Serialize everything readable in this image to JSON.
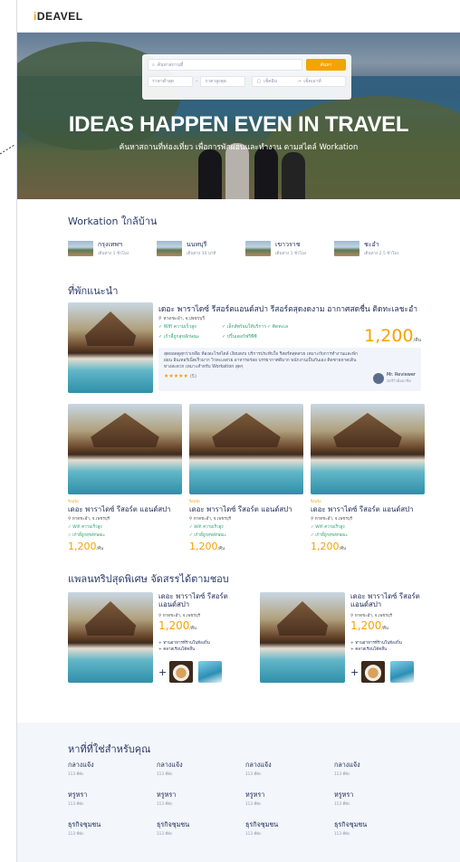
{
  "brand": {
    "logo_i": "i",
    "logo_rest": "DEAVEL"
  },
  "hero": {
    "title": "IDEAS HAPPEN EVEN IN TRAVEL",
    "subtitle": "ค้นหาสถานที่ท่องเที่ยว เพื่อการพักผ่อนและทำงาน ตามสไตล์ Workation",
    "search_placeholder": "ค้นหาสถานที่",
    "search_button": "ค้นหา",
    "price_min": "ราคาต่ำสุด",
    "price_sep": "–",
    "price_max": "ราคาสูงสุด",
    "date_start": "เช็คอิน",
    "date_arrow": "→",
    "date_end": "เช็คเอาท์"
  },
  "nearby": {
    "title": "Workation ใกล้บ้าน",
    "items": [
      {
        "name": "กรุงเทพฯ",
        "sub": "เดินทาง 1 ชั่วโมง"
      },
      {
        "name": "นนทบุรี",
        "sub": "เดินทาง 30 นาที"
      },
      {
        "name": "เขาวราช",
        "sub": "เดินทาง 1 ชั่วโมง"
      },
      {
        "name": "ชะอำ",
        "sub": "เดินทาง 2.5 ชั่วโมง"
      }
    ]
  },
  "recommended": {
    "title": "ที่พักแนะนำ",
    "featured": {
      "title": "เดอะ พาราไดซ์ รีสอร์ตแอนด์สปา รีสอร์ตสุดงดงาม อากาศสดชื่น ติดทะเลชะอำ",
      "location": "หาดชะอำ, จ.เพชรบุรี",
      "tags": [
        "Wifi ความเร็วสูง",
        "เล็กส์พร้อมให้บริการ",
        "ติดทะเล",
        "เก้าอี้ถูกสุขลักษณะ",
        "ปริ้นเตอร์ฟรีพีซี"
      ],
      "price": "1,200",
      "unit": "/คืน",
      "review": "สุดยอดดูสุกว่าเหลือ ห้องอะไรสไตล์ เงียบสงบ บริการประทับใจ รีสอร์ตสุดสวย เหมาะกับการทำงานและพักผ่อน อินเทอร์เน็ตเร็วมาก วิวทะเลสวย อาหารอร่อย บรรยากาศดีมาก พนักงานเป็นกันเอง ติดชายหาดเดินทางสะดวก เหมาะสำหรับ Workation สุดๆ",
      "stars": "★★★★★",
      "review_count": "(5)",
      "reviewer": "Mr. Reviewer",
      "reviewer_role": "นักรีวิวมืออาชีพ"
    },
    "cards": [
      {
        "category": "รีสอร์ต",
        "title": "เดอะ พาราไดซ์ รีสอร์ต แอนด์สปา",
        "location": "หาดชะอำ, จ.เพชรบุรี",
        "tag1": "Wifi ความเร็วสูง",
        "tag2": "เก้าอี้ถูกสุขลักษณะ",
        "price": "1,200",
        "unit": "/คืน"
      },
      {
        "category": "รีสอร์ต",
        "title": "เดอะ พาราไดซ์ รีสอร์ต แอนด์สปา",
        "location": "หาดชะอำ, จ.เพชรบุรี",
        "tag1": "Wifi ความเร็วสูง",
        "tag2": "เก้าอี้ถูกสุขลักษณะ",
        "price": "1,200",
        "unit": "/คืน"
      },
      {
        "category": "รีสอร์ต",
        "title": "เดอะ พาราไดซ์ รีสอร์ต แอนด์สปา",
        "location": "หาดชะอำ, จ.เพชรบุรี",
        "tag1": "Wifi ความเร็วสูง",
        "tag2": "เก้าอี้ถูกสุขลักษณะ",
        "price": "1,200",
        "unit": "/คืน"
      }
    ]
  },
  "plans": {
    "title": "แพลนทริปสุดพิเศษ จัดสรรได้ตามชอบ",
    "items": [
      {
        "title": "เดอะ พาราไดซ์ รีสอร์ต แอนด์สปา",
        "location": "หาดชะอำ, จ.เพชรบุรี",
        "price": "1,200",
        "unit": "/คืน",
        "feat1": "+ ทานอาหารที่ร้านในท้องถิ่น",
        "feat2": "+ คลาสเรียนโต้คลื่น",
        "plus": "+"
      },
      {
        "title": "เดอะ พาราไดซ์ รีสอร์ต แอนด์สปา",
        "location": "หาดชะอำ, จ.เพชรบุรี",
        "price": "1,200",
        "unit": "/คืน",
        "feat1": "+ ทานอาหารที่ร้านในท้องถิ่น",
        "feat2": "+ คลาสเรียนโต้คลื่น",
        "plus": "+"
      }
    ]
  },
  "places": {
    "title": "หาที่ที่ใช่สำหรับคุณ",
    "rows": [
      [
        {
          "name": "กลางแจ้ง",
          "sub": "113 ที่พัก"
        },
        {
          "name": "กลางแจ้ง",
          "sub": "113 ที่พัก"
        },
        {
          "name": "กลางแจ้ง",
          "sub": "113 ที่พัก"
        },
        {
          "name": "กลางแจ้ง",
          "sub": "113 ที่พัก"
        }
      ],
      [
        {
          "name": "หรูหรา",
          "sub": "113 ที่พัก"
        },
        {
          "name": "หรูหรา",
          "sub": "113 ที่พัก"
        },
        {
          "name": "หรูหรา",
          "sub": "113 ที่พัก"
        },
        {
          "name": "หรูหรา",
          "sub": "113 ที่พัก"
        }
      ],
      [
        {
          "name": "ธุรกิจชุมชน",
          "sub": "113 ที่พัก"
        },
        {
          "name": "ธุรกิจชุมชน",
          "sub": "113 ที่พัก"
        },
        {
          "name": "ธุรกิจชุมชน",
          "sub": "113 ที่พัก"
        },
        {
          "name": "ธุรกิจชุมชน",
          "sub": "113 ที่พัก"
        }
      ]
    ]
  },
  "colors": {
    "accent": "#f4a300",
    "primary_text": "#1c2a55",
    "tag_green": "#2ba36b"
  }
}
